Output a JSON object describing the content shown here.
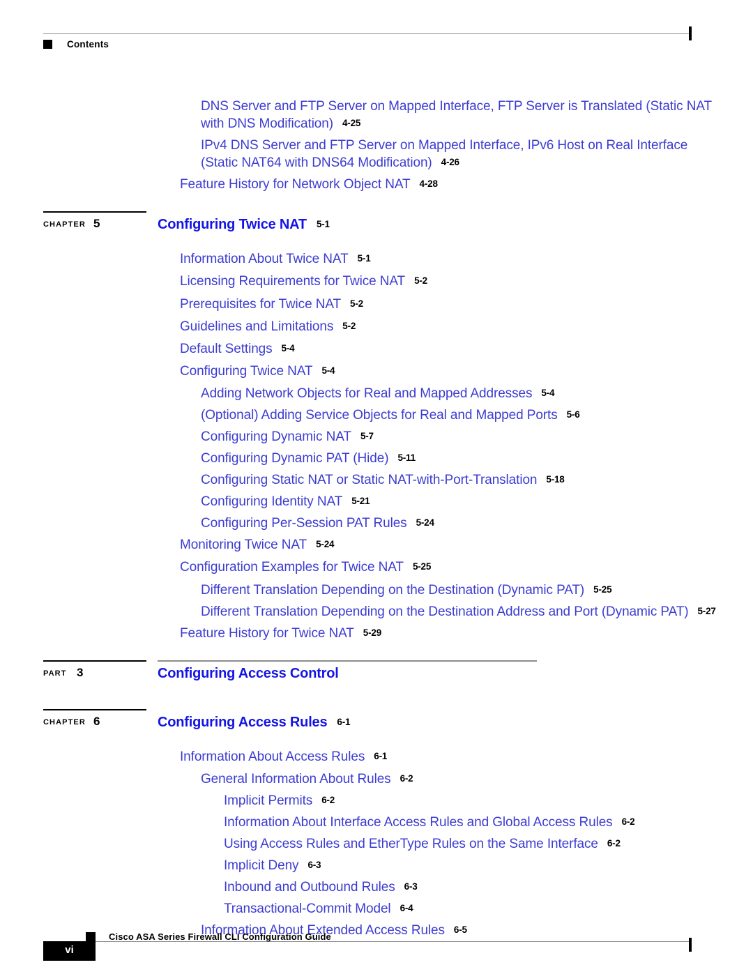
{
  "header": {
    "label": "Contents",
    "square_icon": "black-square-icon"
  },
  "footer": {
    "page_number": "vi",
    "title": "Cisco ASA Series Firewall CLI Configuration Guide",
    "square_icon": "black-square-icon"
  },
  "colors": {
    "heading_blue": "#1414e6",
    "entry_blue": "#3c3cd2",
    "rule_gray": "#8c8c8c",
    "black": "#000000"
  },
  "toc": {
    "top_entries": [
      {
        "level": 2,
        "text": "DNS Server and FTP Server on Mapped Interface, FTP Server is Translated (Static NAT with DNS Modification)",
        "page": "4-25",
        "wrap": true
      },
      {
        "level": 2,
        "text": "IPv4 DNS Server and FTP Server on Mapped Interface, IPv6 Host on Real Interface (Static NAT64 with DNS64 Modification)",
        "page": "4-26",
        "wrap": true
      },
      {
        "level": 1,
        "text": "Feature History for Network Object NAT",
        "page": "4-28",
        "wrap": false
      }
    ],
    "blocks": [
      {
        "kind": "CHAPTER",
        "number": "5",
        "title": "Configuring Twice NAT",
        "page": "5-1",
        "long_rule": false,
        "entries": [
          {
            "level": 1,
            "text": "Information About Twice NAT",
            "page": "5-1",
            "wrap": false
          },
          {
            "level": 1,
            "text": "Licensing Requirements for Twice NAT",
            "page": "5-2",
            "wrap": false
          },
          {
            "level": 1,
            "text": "Prerequisites for Twice NAT",
            "page": "5-2",
            "wrap": false
          },
          {
            "level": 1,
            "text": "Guidelines and Limitations",
            "page": "5-2",
            "wrap": false
          },
          {
            "level": 1,
            "text": "Default Settings",
            "page": "5-4",
            "wrap": false
          },
          {
            "level": 1,
            "text": "Configuring Twice NAT",
            "page": "5-4",
            "wrap": false
          },
          {
            "level": 2,
            "text": "Adding Network Objects for Real and Mapped Addresses",
            "page": "5-4",
            "wrap": false
          },
          {
            "level": 2,
            "text": "(Optional) Adding Service Objects for Real and Mapped Ports",
            "page": "5-6",
            "wrap": false
          },
          {
            "level": 2,
            "text": "Configuring Dynamic NAT",
            "page": "5-7",
            "wrap": false
          },
          {
            "level": 2,
            "text": "Configuring Dynamic PAT (Hide)",
            "page": "5-11",
            "wrap": false
          },
          {
            "level": 2,
            "text": "Configuring Static NAT or Static NAT-with-Port-Translation",
            "page": "5-18",
            "wrap": false
          },
          {
            "level": 2,
            "text": "Configuring Identity NAT",
            "page": "5-21",
            "wrap": false
          },
          {
            "level": 2,
            "text": "Configuring Per-Session PAT Rules",
            "page": "5-24",
            "wrap": false
          },
          {
            "level": 1,
            "text": "Monitoring Twice NAT",
            "page": "5-24",
            "wrap": false
          },
          {
            "level": 1,
            "text": "Configuration Examples for Twice NAT",
            "page": "5-25",
            "wrap": false
          },
          {
            "level": 2,
            "text": "Different Translation Depending on the Destination (Dynamic PAT)",
            "page": "5-25",
            "wrap": false
          },
          {
            "level": 2,
            "text": "Different Translation Depending on the Destination Address and Port (Dynamic PAT)",
            "page": "5-27",
            "wrap": false
          },
          {
            "level": 1,
            "text": "Feature History for Twice NAT",
            "page": "5-29",
            "wrap": false
          }
        ]
      },
      {
        "kind": "PART",
        "number": "3",
        "title": "Configuring Access Control",
        "page": "",
        "long_rule": true,
        "entries": []
      },
      {
        "kind": "CHAPTER",
        "number": "6",
        "title": "Configuring Access Rules",
        "page": "6-1",
        "long_rule": false,
        "entries": [
          {
            "level": 1,
            "text": "Information About Access Rules",
            "page": "6-1",
            "wrap": false
          },
          {
            "level": 2,
            "text": "General Information About Rules",
            "page": "6-2",
            "wrap": false
          },
          {
            "level": 3,
            "text": "Implicit Permits",
            "page": "6-2",
            "wrap": false
          },
          {
            "level": 3,
            "text": "Information About Interface Access Rules and Global Access Rules",
            "page": "6-2",
            "wrap": false
          },
          {
            "level": 3,
            "text": "Using Access Rules and EtherType Rules on the Same Interface",
            "page": "6-2",
            "wrap": false
          },
          {
            "level": 3,
            "text": "Implicit Deny",
            "page": "6-3",
            "wrap": false
          },
          {
            "level": 3,
            "text": "Inbound and Outbound Rules",
            "page": "6-3",
            "wrap": false
          },
          {
            "level": 3,
            "text": "Transactional-Commit Model",
            "page": "6-4",
            "wrap": false
          },
          {
            "level": 2,
            "text": "Information About Extended Access Rules",
            "page": "6-5",
            "wrap": false
          }
        ]
      }
    ]
  }
}
